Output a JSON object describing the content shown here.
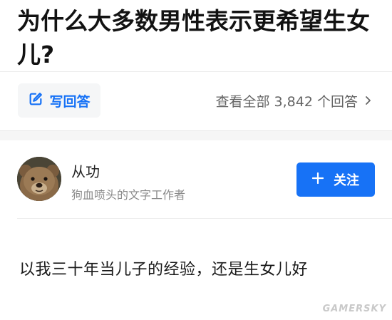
{
  "question": {
    "title": "为什么大多数男性表示更希望生女儿?",
    "write_answer_label": "写回答",
    "view_all_label": "查看全部 3,842 个回答",
    "write_icon": "edit-icon",
    "chevron_icon": "chevron-right-icon"
  },
  "answer": {
    "author_name": "从功",
    "author_bio": "狗血喷头的文字工作者",
    "follow_label": "关注",
    "follow_icon": "plus-icon",
    "excerpt": "以我三十年当儿子的经验，还是生女儿好"
  },
  "watermark": "GAMERSKY",
  "colors": {
    "accent": "#1772f6",
    "background": "#f6f6f6",
    "muted_text": "#8a8a8a"
  }
}
